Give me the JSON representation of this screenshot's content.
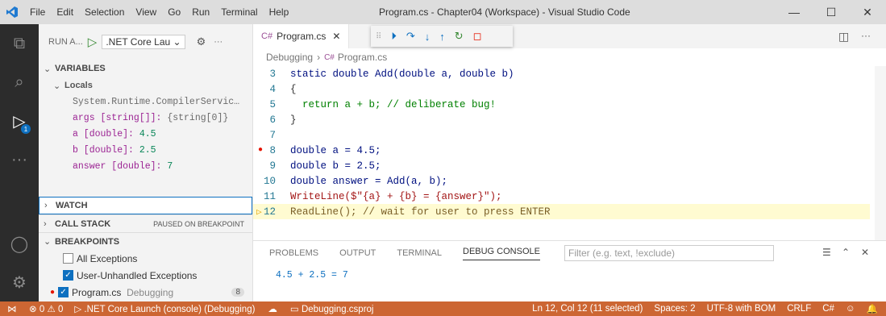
{
  "titlebar": {
    "menu": [
      "File",
      "Edit",
      "Selection",
      "View",
      "Go",
      "Run",
      "Terminal",
      "Help"
    ],
    "title": "Program.cs - Chapter04 (Workspace) - Visual Studio Code",
    "min": "—",
    "max": "☐",
    "close": "✕"
  },
  "activity": {
    "badge": "1"
  },
  "sidebar": {
    "run_label": "RUN A...",
    "config": ".NET Core Lau",
    "more": "···",
    "variables_title": "VARIABLES",
    "locals_title": "Locals",
    "locals": [
      {
        "name": "System.Runtime.CompilerServic…",
        "value": ""
      },
      {
        "name": "args [string[]]:",
        "value": "{string[0]}"
      },
      {
        "name": "a [double]:",
        "value": "4.5"
      },
      {
        "name": "b [double]:",
        "value": "2.5"
      },
      {
        "name": "answer [double]:",
        "value": "7"
      }
    ],
    "watch_title": "WATCH",
    "callstack_title": "CALL STACK",
    "callstack_status": "PAUSED ON BREAKPOINT",
    "breakpoints_title": "BREAKPOINTS",
    "breakpoints": [
      {
        "label": "All Exceptions",
        "checked": false
      },
      {
        "label": "User-Unhandled Exceptions",
        "checked": true
      },
      {
        "label": "Program.cs",
        "sub": "Debugging",
        "count": "8",
        "checked": true
      }
    ]
  },
  "editor": {
    "tab_label": "Program.cs",
    "breadcrumb": [
      "Debugging",
      "Program.cs"
    ],
    "lines": [
      {
        "n": "3",
        "text": "static double Add(double a, double b)"
      },
      {
        "n": "4",
        "text": "{"
      },
      {
        "n": "5",
        "text": "  return a + b; // deliberate bug!"
      },
      {
        "n": "6",
        "text": "}"
      },
      {
        "n": "7",
        "text": ""
      },
      {
        "n": "8",
        "text": "double a = 4.5;"
      },
      {
        "n": "9",
        "text": "double b = 2.5;"
      },
      {
        "n": "10",
        "text": "double answer = Add(a, b);"
      },
      {
        "n": "11",
        "text": "WriteLine($\"{a} + {b} = {answer}\");"
      },
      {
        "n": "12",
        "text": "ReadLine(); // wait for user to press ENTER"
      }
    ]
  },
  "panel": {
    "tabs": [
      "PROBLEMS",
      "OUTPUT",
      "TERMINAL",
      "DEBUG CONSOLE"
    ],
    "filter_placeholder": "Filter (e.g. text, !exclude)",
    "output": "4.5 + 2.5 = 7",
    "prompt": ">"
  },
  "status": {
    "errors": "0",
    "warnings": "0",
    "launch": ".NET Core Launch (console) (Debugging)",
    "project": "Debugging.csproj",
    "position": "Ln 12, Col 12 (11 selected)",
    "spaces": "Spaces: 2",
    "encoding": "UTF-8 with BOM",
    "eol": "CRLF",
    "lang": "C#"
  },
  "colors": {
    "status_bg": "#cc6633",
    "activity_bg": "#2c2c2c",
    "current_line": "#fffbd1"
  }
}
